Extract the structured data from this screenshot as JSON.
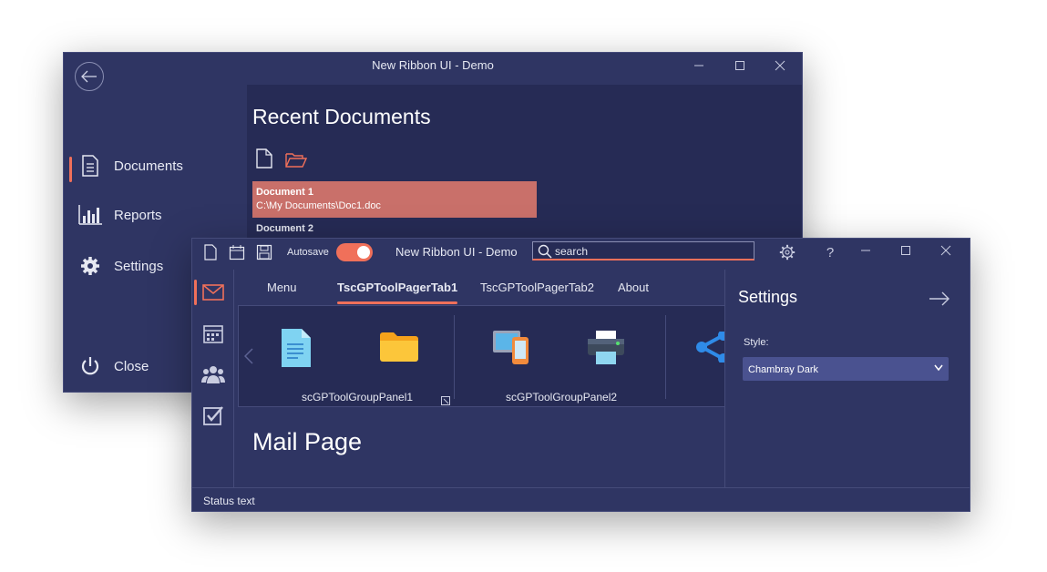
{
  "back_window": {
    "title": "New Ribbon UI - Demo",
    "sidebar": {
      "items": [
        {
          "label": "Documents",
          "icon": "document-icon",
          "active": true
        },
        {
          "label": "Reports",
          "icon": "chart-icon"
        },
        {
          "label": "Settings",
          "icon": "gear-icon"
        },
        {
          "label": "Close",
          "icon": "power-icon"
        }
      ]
    },
    "recent": {
      "title": "Recent Documents",
      "documents": [
        {
          "name": "Document 1",
          "path": "C:\\My Documents\\Doc1.doc"
        },
        {
          "name": "Document 2",
          "path": ""
        }
      ]
    }
  },
  "front_window": {
    "title": "New Ribbon UI - Demo",
    "autosave_label": "Autosave",
    "search_placeholder": "search",
    "tabs": [
      "Menu",
      "TscGPToolPagerTab1",
      "TscGPToolPagerTab2",
      "About"
    ],
    "active_tab": 1,
    "groups": [
      "scGPToolGroupPanel1",
      "scGPToolGroupPanel2"
    ],
    "page_title": "Mail Page",
    "status_text": "Status text",
    "settings": {
      "title": "Settings",
      "style_label": "Style:",
      "style_value": "Chambray Dark"
    }
  },
  "colors": {
    "accent": "#f0705a",
    "window_bg": "#2f3563",
    "content_bg": "#262b55",
    "selected_doc": "#c9706a"
  }
}
